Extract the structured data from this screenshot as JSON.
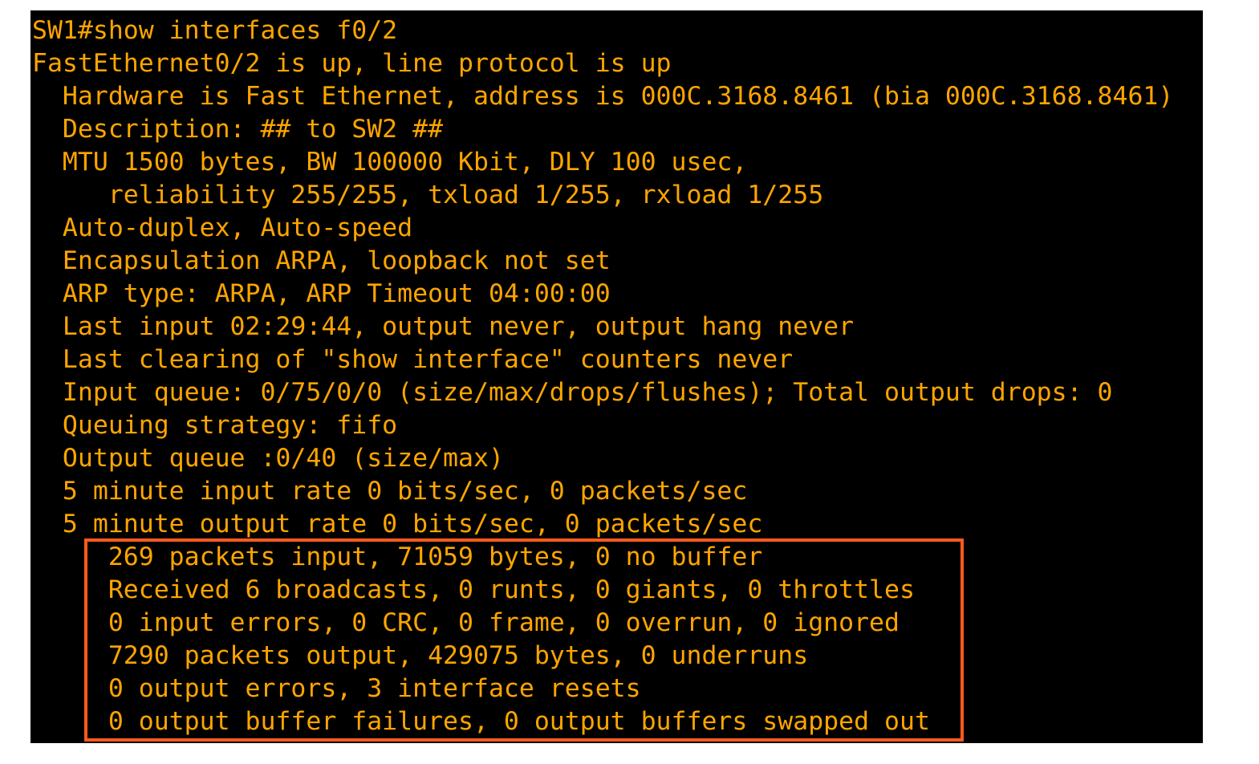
{
  "terminal": {
    "text_color": "#FFA500",
    "background_color": "#000000",
    "lines": [
      "SW1#show interfaces f0/2",
      "FastEthernet0/2 is up, line protocol is up",
      "  Hardware is Fast Ethernet, address is 000C.3168.8461 (bia 000C.3168.8461)",
      "  Description: ## to SW2 ##",
      "  MTU 1500 bytes, BW 100000 Kbit, DLY 100 usec,",
      "     reliability 255/255, txload 1/255, rxload 1/255",
      "  Auto-duplex, Auto-speed",
      "  Encapsulation ARPA, loopback not set",
      "  ARP type: ARPA, ARP Timeout 04:00:00",
      "  Last input 02:29:44, output never, output hang never",
      "  Last clearing of \"show interface\" counters never",
      "  Input queue: 0/75/0/0 (size/max/drops/flushes); Total output drops: 0",
      "  Queuing strategy: fifo",
      "  Output queue :0/40 (size/max)",
      "  5 minute input rate 0 bits/sec, 0 packets/sec",
      "  5 minute output rate 0 bits/sec, 0 packets/sec",
      "     269 packets input, 71059 bytes, 0 no buffer",
      "     Received 6 broadcasts, 0 runts, 0 giants, 0 throttles",
      "     0 input errors, 0 CRC, 0 frame, 0 overrun, 0 ignored",
      "     7290 packets output, 429075 bytes, 0 underruns",
      "     0 output errors, 3 interface resets",
      "     0 output buffer failures, 0 output buffers swapped out"
    ]
  },
  "highlight": {
    "color": "#FF5A1F"
  }
}
